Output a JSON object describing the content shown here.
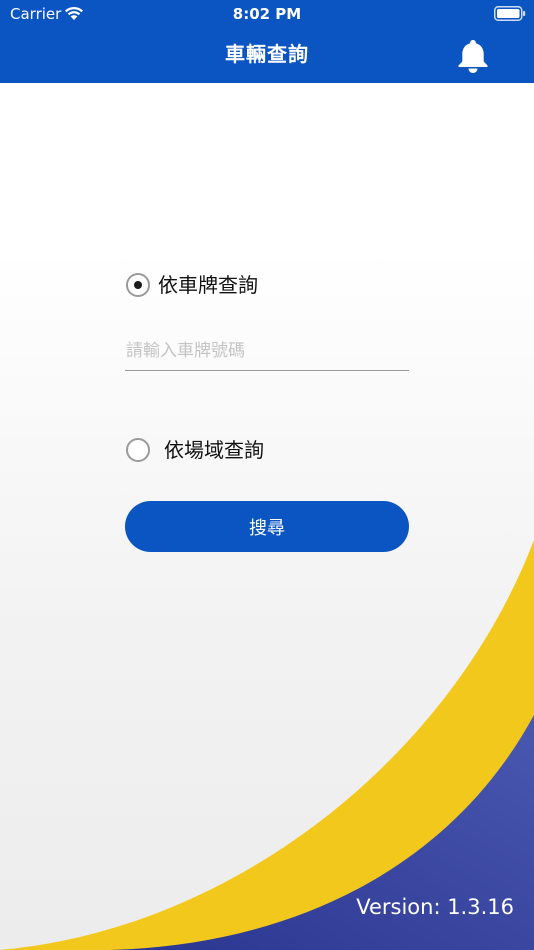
{
  "status_bar": {
    "carrier": "Carrier",
    "time": "8:02 PM",
    "icons": [
      "wifi-icon",
      "battery-icon"
    ]
  },
  "header": {
    "title": "車輛查詢",
    "notification_icon": "bell-icon"
  },
  "query_options": {
    "by_plate": {
      "label": "依車牌查詢",
      "selected": true
    },
    "by_site": {
      "label": "依場域查詢",
      "selected": false
    }
  },
  "plate_input": {
    "placeholder": "請輸入車牌號碼",
    "value": ""
  },
  "search_button": {
    "label": "搜尋"
  },
  "footer": {
    "version": "Version: 1.3.16"
  },
  "colors": {
    "primary": "#0b55c3",
    "accent_yellow": "#f2c81d",
    "accent_indigo": "#3f4ea5",
    "background": "#f3f3f3"
  }
}
